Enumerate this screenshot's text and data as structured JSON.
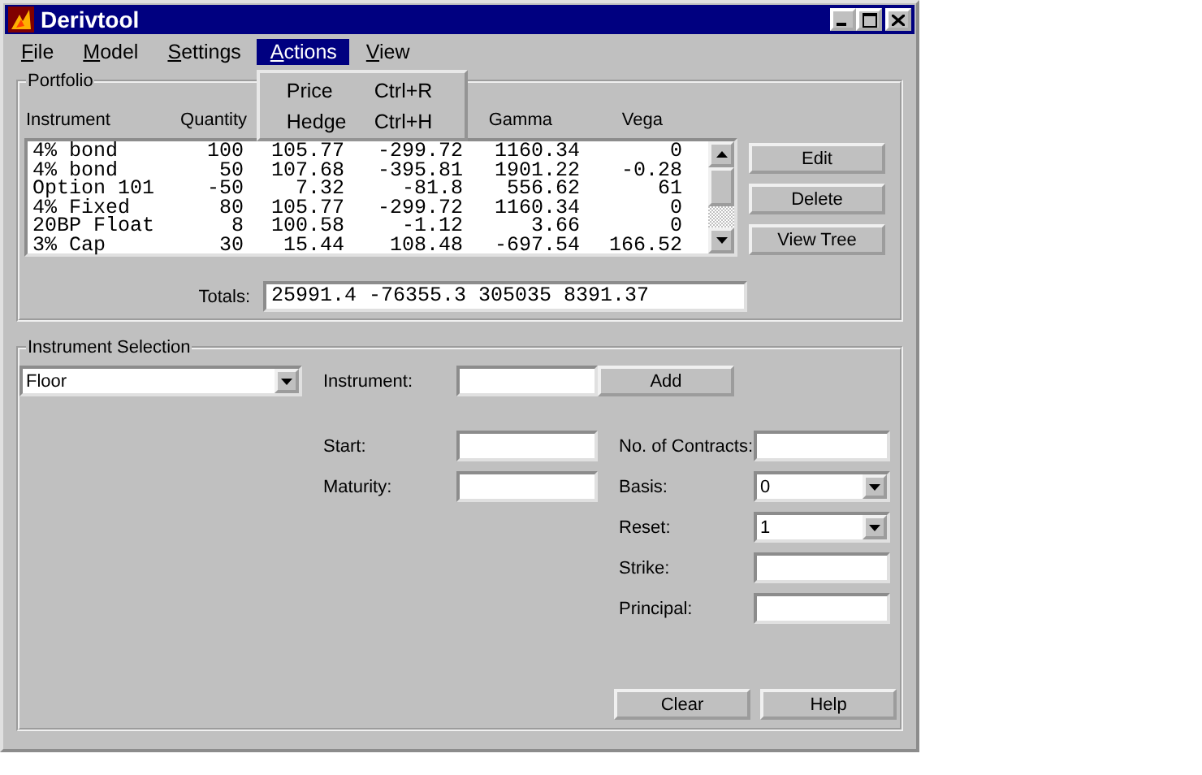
{
  "window": {
    "title": "Derivtool"
  },
  "menu_bar": [
    {
      "label": "File",
      "selected": false
    },
    {
      "label": "Model",
      "selected": false
    },
    {
      "label": "Settings",
      "selected": false
    },
    {
      "label": "Actions",
      "selected": true
    },
    {
      "label": "View",
      "selected": false
    }
  ],
  "open_menu": [
    {
      "label": "Price",
      "shortcut": "Ctrl+R"
    },
    {
      "label": "Hedge",
      "shortcut": "Ctrl+H"
    }
  ],
  "portfolio": {
    "title": "Portfolio",
    "columns": [
      {
        "label": "Instrument"
      },
      {
        "label": "Quantity"
      },
      {},
      {},
      {
        "label": "Gamma"
      },
      {
        "label": "Vega"
      }
    ],
    "rows": [
      [
        "4% bond",
        "100",
        "105.77",
        "-299.72",
        "1160.34",
        "0"
      ],
      [
        "4% bond",
        "50",
        "107.68",
        "-395.81",
        "1901.22",
        "-0.28"
      ],
      [
        "Option 101",
        "-50",
        "7.32",
        "-81.8",
        "556.62",
        "61"
      ],
      [
        "4% Fixed",
        "80",
        "105.77",
        "-299.72",
        "1160.34",
        "0"
      ],
      [
        "20BP Float",
        "8",
        "100.58",
        "-1.12",
        "3.66",
        "0"
      ],
      [
        "3% Cap",
        "30",
        "15.44",
        "108.48",
        "-697.54",
        "166.52"
      ]
    ],
    "buttons": [
      "Edit",
      "Delete",
      "View Tree"
    ],
    "totals_label": "Totals:",
    "totals_value": "25991.4 -76355.3 305035 8391.37"
  },
  "instrument_selection": {
    "title": "Instrument Selection",
    "type": "Floor",
    "instrument_label": "Instrument:",
    "add_button": "Add",
    "start_label": "Start:",
    "maturity_label": "Maturity:",
    "contracts_label": "No. of Contracts:",
    "basis_label": "Basis:",
    "basis_value": "0",
    "reset_label": "Reset:",
    "reset_value": "1",
    "strike_label": "Strike:",
    "principal_label": "Principal:",
    "buttons": [
      "Clear",
      "Help"
    ]
  }
}
